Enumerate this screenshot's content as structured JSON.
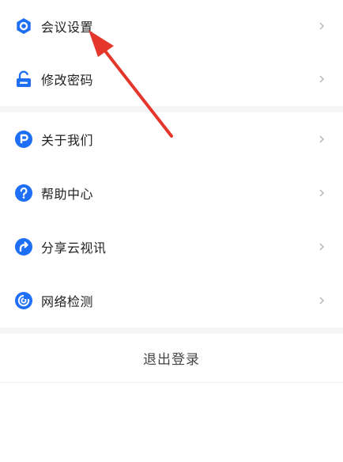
{
  "menu_group_1": [
    {
      "label": "会议设置",
      "icon": "hexagon-settings-icon"
    },
    {
      "label": "修改密码",
      "icon": "unlock-icon"
    }
  ],
  "menu_group_2": [
    {
      "label": "关于我们",
      "icon": "p-circle-icon"
    },
    {
      "label": "帮助中心",
      "icon": "question-circle-icon"
    },
    {
      "label": "分享云视讯",
      "icon": "share-circle-icon"
    },
    {
      "label": "网络检测",
      "icon": "network-circle-icon"
    }
  ],
  "logout_label": "退出登录",
  "chevron_glyph": "›",
  "colors": {
    "icon_blue": "#1e6ff5",
    "annotation_red": "#e5362c",
    "separator": "#f4f5f7",
    "chevron": "#b8b8b8"
  }
}
